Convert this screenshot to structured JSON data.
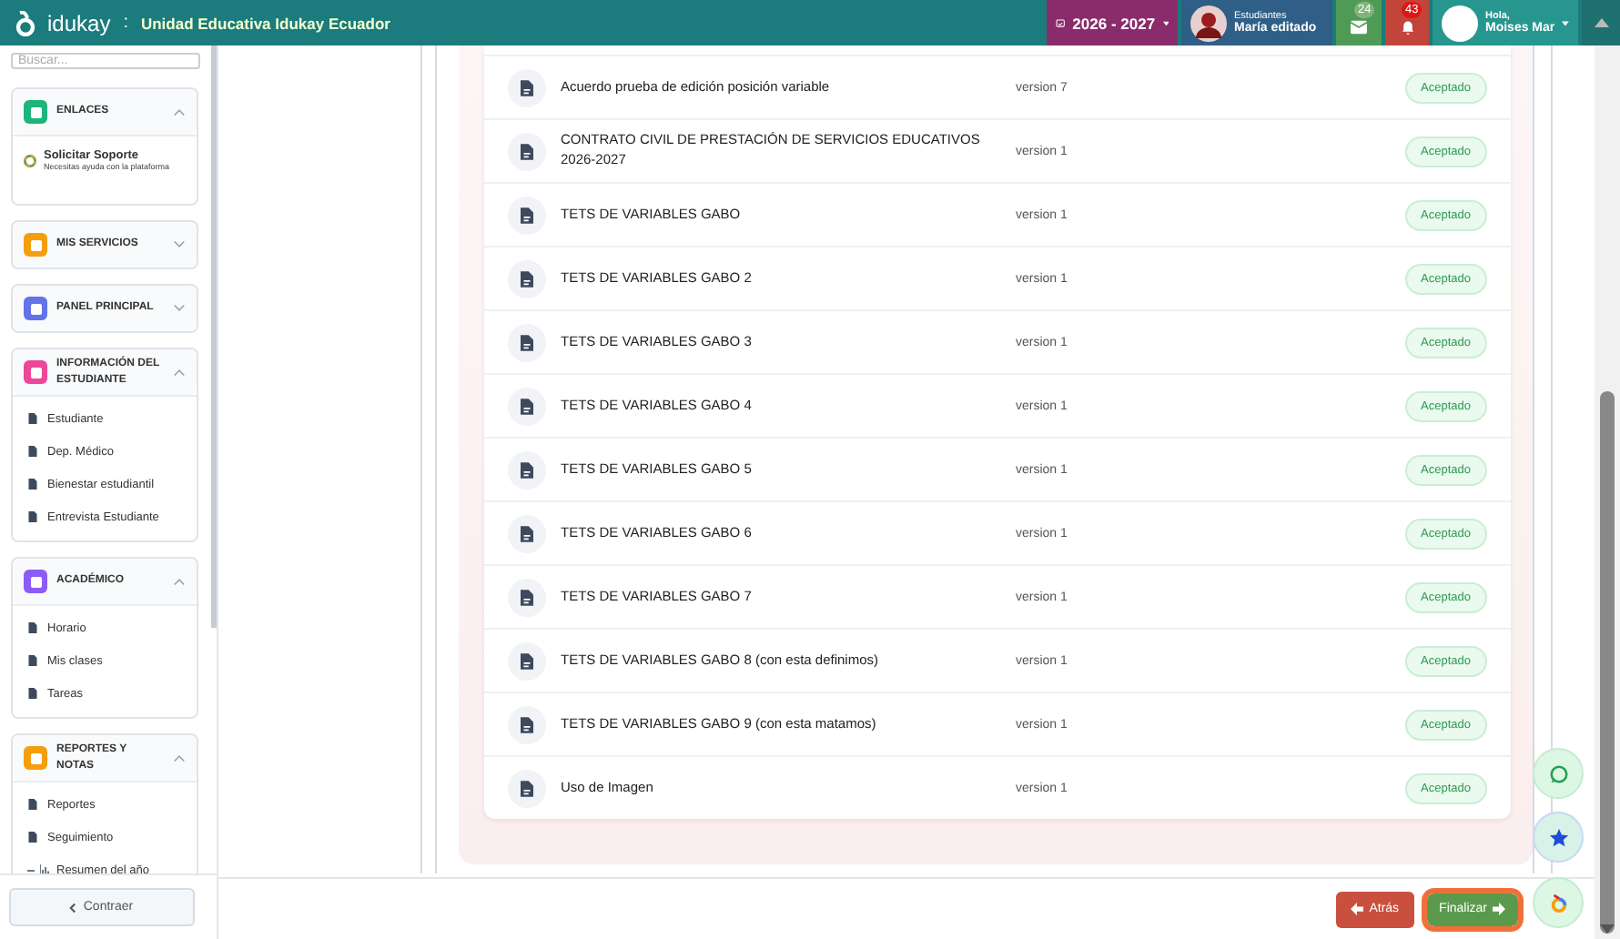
{
  "header": {
    "logo": "idukay",
    "separator": ":",
    "school": "Unidad Educativa Idukay Ecuador",
    "year": "2026 - 2027",
    "student": {
      "label": "Estudiantes",
      "name": "María editado"
    },
    "messages_count": "24",
    "notifications_count": "43",
    "user": {
      "greeting": "Hola,",
      "name": "Moises Mar"
    }
  },
  "sidebar": {
    "search_placeholder": "Buscar...",
    "sections": [
      {
        "title": "ENLACES",
        "color": "#1db57c",
        "expanded": true,
        "items": [
          {
            "label": "Solicitar Soporte",
            "description": "Necesitas ayuda con la plataforma"
          }
        ]
      },
      {
        "title": "MIS SERVICIOS",
        "color": "#f59e0b",
        "expanded": false
      },
      {
        "title": "PANEL PRINCIPAL",
        "color": "#6373e8",
        "expanded": false
      },
      {
        "title": "INFORMACIÓN DEL ESTUDIANTE",
        "color": "#ec4899",
        "expanded": true,
        "items": [
          {
            "label": "Estudiante"
          },
          {
            "label": "Dep. Médico"
          },
          {
            "label": "Bienestar estudiantil"
          },
          {
            "label": "Entrevista Estudiante"
          }
        ]
      },
      {
        "title": "ACADÉMICO",
        "color": "#8b5cf6",
        "expanded": true,
        "items": [
          {
            "label": "Horario"
          },
          {
            "label": "Mis clases"
          },
          {
            "label": "Tareas"
          }
        ]
      },
      {
        "title": "REPORTES Y NOTAS",
        "color": "#f59e0b",
        "expanded": true,
        "items": [
          {
            "label": "Reportes"
          },
          {
            "label": "Seguimiento",
            "children": [
              {
                "label": "Resumen del año"
              }
            ]
          }
        ]
      }
    ],
    "collapse_button": "Contraer"
  },
  "documents": [
    {
      "title": "Acuerdo prueba de edición posición variable",
      "version": "version 7",
      "status": "Aceptado"
    },
    {
      "title": "CONTRATO CIVIL DE PRESTACIÓN DE SERVICIOS EDUCATIVOS 2026-2027",
      "version": "version 1",
      "status": "Aceptado"
    },
    {
      "title": "TETS DE VARIABLES GABO",
      "version": "version 1",
      "status": "Aceptado"
    },
    {
      "title": "TETS DE VARIABLES GABO 2",
      "version": "version 1",
      "status": "Aceptado"
    },
    {
      "title": "TETS DE VARIABLES GABO 3",
      "version": "version 1",
      "status": "Aceptado"
    },
    {
      "title": "TETS DE VARIABLES GABO 4",
      "version": "version 1",
      "status": "Aceptado"
    },
    {
      "title": "TETS DE VARIABLES GABO 5",
      "version": "version 1",
      "status": "Aceptado"
    },
    {
      "title": "TETS DE VARIABLES GABO 6",
      "version": "version 1",
      "status": "Aceptado"
    },
    {
      "title": "TETS DE VARIABLES GABO 7",
      "version": "version 1",
      "status": "Aceptado"
    },
    {
      "title": "TETS DE VARIABLES GABO 8 (con esta definimos)",
      "version": "version 1",
      "status": "Aceptado"
    },
    {
      "title": "TETS DE VARIABLES GABO 9 (con esta matamos)",
      "version": "version 1",
      "status": "Aceptado"
    },
    {
      "title": "Uso de Imagen",
      "version": "version 1",
      "status": "Aceptado"
    }
  ],
  "buttons": {
    "back": "Atrás",
    "finish": "Finalizar"
  }
}
